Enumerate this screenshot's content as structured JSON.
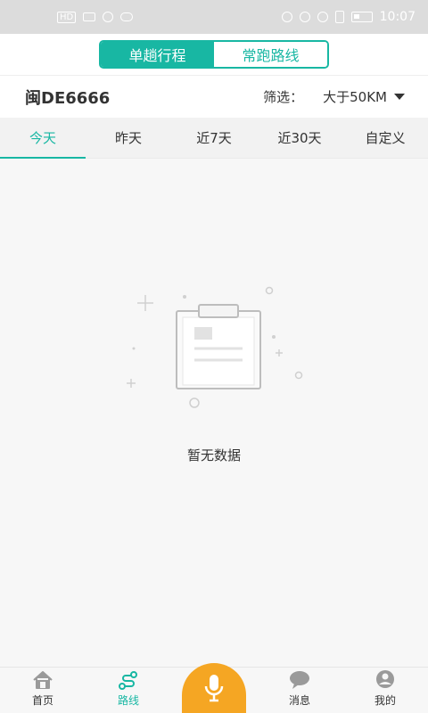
{
  "status_bar": {
    "time": "10:07",
    "left_text": "HD"
  },
  "header": {
    "segments": [
      {
        "label": "单趟行程",
        "active": true
      },
      {
        "label": "常跑路线",
        "active": false
      }
    ]
  },
  "vehicle": {
    "plate": "闽DE6666"
  },
  "filter": {
    "label": "筛选：",
    "value": "大于50KM"
  },
  "tabs": [
    {
      "label": "今天",
      "active": true
    },
    {
      "label": "昨天",
      "active": false
    },
    {
      "label": "近7天",
      "active": false
    },
    {
      "label": "近30天",
      "active": false
    },
    {
      "label": "自定义",
      "active": false
    }
  ],
  "empty_state": {
    "message": "暂无数据"
  },
  "bottom_nav": [
    {
      "label": "首页",
      "icon": "home-icon"
    },
    {
      "label": "路线",
      "icon": "route-icon",
      "active": true
    },
    {
      "label": "",
      "icon": "microphone-icon"
    },
    {
      "label": "消息",
      "icon": "message-icon"
    },
    {
      "label": "我的",
      "icon": "user-icon"
    }
  ],
  "colors": {
    "accent": "#18b7a3",
    "mic": "#f5a623",
    "status_bar": "#dcdcdc"
  }
}
